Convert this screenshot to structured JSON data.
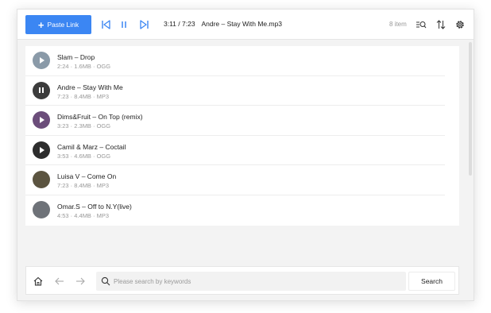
{
  "toolbar": {
    "paste_label": "Paste Link",
    "now_time": "3:11 / 7:23",
    "now_title": "Andre – Stay With Me.mp3",
    "item_count": "8 item"
  },
  "tracks": [
    {
      "title": "Slam – Drop",
      "meta": "2:24 · 1.6MB · OGG",
      "state": "play",
      "color": "#8a9aa8"
    },
    {
      "title": "Andre – Stay With Me",
      "meta": "7:23 · 8.4MB · MP3",
      "state": "pause",
      "color": "#3c3c3c"
    },
    {
      "title": "Dims&Fruit – On Top (remix)",
      "meta": "3:23 · 2.3MB · OGG",
      "state": "play",
      "color": "#6b4d7a"
    },
    {
      "title": "Camil & Marz – Coctail",
      "meta": "3:53 · 4.6MB · OGG",
      "state": "play",
      "color": "#2d2d2d"
    },
    {
      "title": "Luisa V – Come On",
      "meta": "7:23 · 8.4MB · MP3",
      "state": "none",
      "color": "#5b5440"
    },
    {
      "title": "Omar.S – Off to N.Y(live)",
      "meta": "4:53 · 4.4MB · MP3",
      "state": "none",
      "color": "#6e7278"
    }
  ],
  "search": {
    "placeholder": "Please search by keywords",
    "button_label": "Search"
  },
  "colors": {
    "accent": "#3b86f3"
  }
}
